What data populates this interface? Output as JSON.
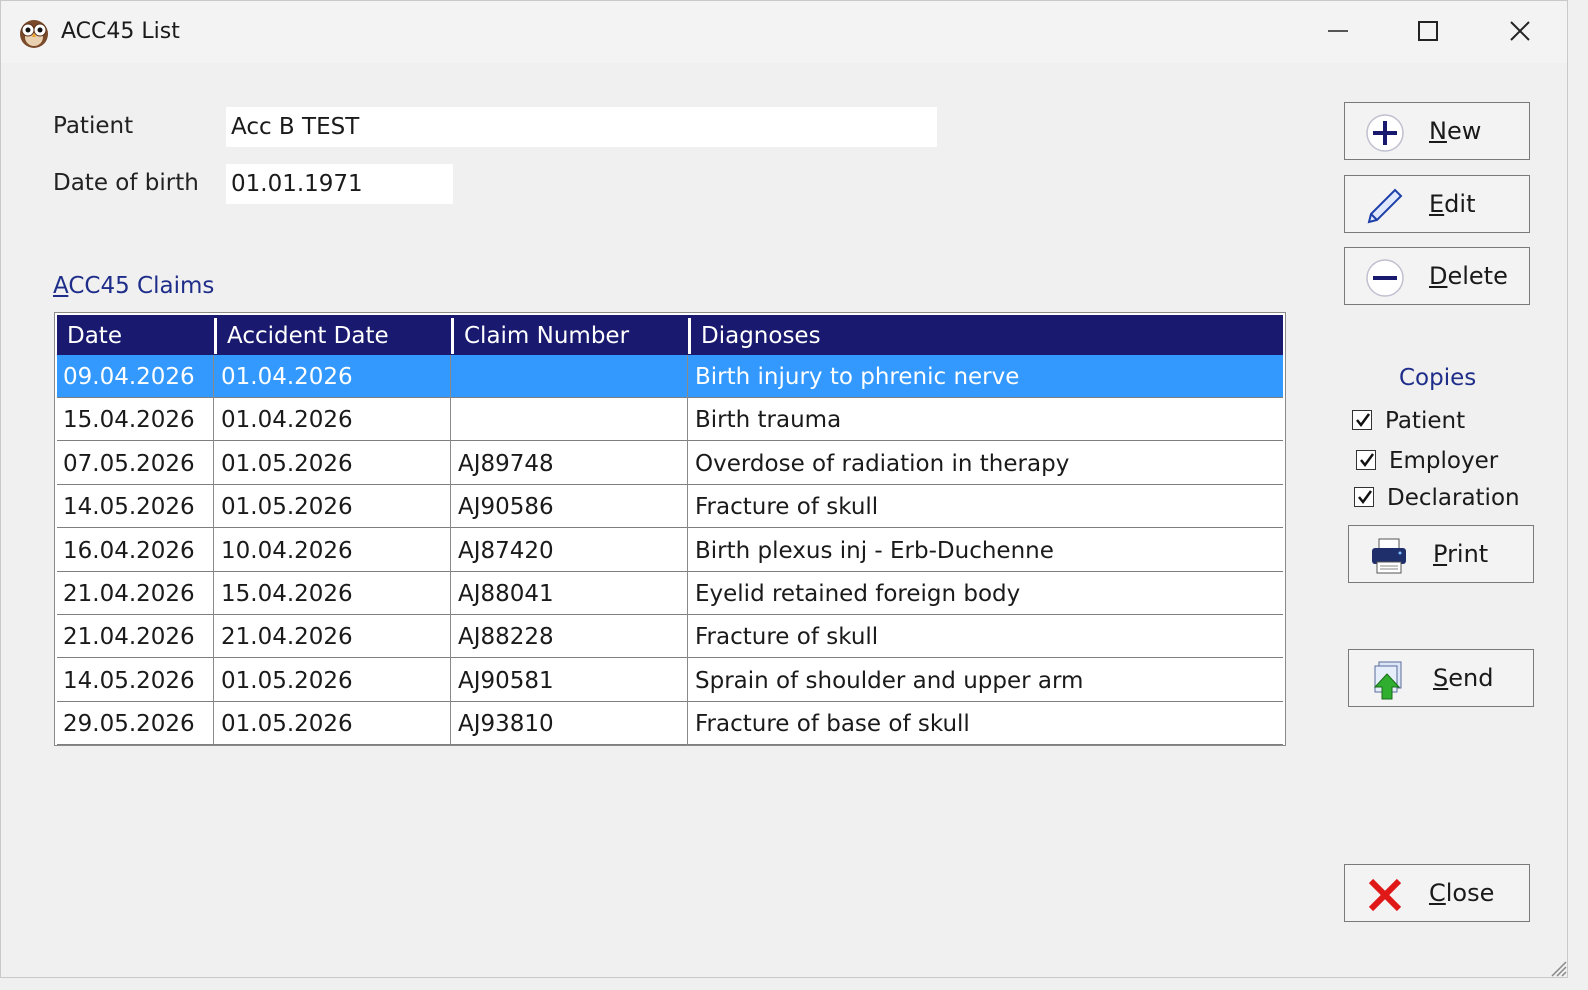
{
  "window": {
    "title": "ACC45 List"
  },
  "patient": {
    "label": "Patient",
    "value": "Acc B TEST"
  },
  "dob": {
    "label": "Date of birth",
    "value": "01.01.1971"
  },
  "claims": {
    "title": "ACC45 Claims",
    "columns": [
      "Date",
      "Accident Date",
      "Claim Number",
      "Diagnoses"
    ],
    "rows": [
      [
        "09.04.2026",
        "01.04.2026",
        "",
        "Birth injury to phrenic nerve"
      ],
      [
        "15.04.2026",
        "01.04.2026",
        "",
        "Birth trauma"
      ],
      [
        "07.05.2026",
        "01.05.2026",
        "AJ89748",
        "Overdose of radiation in therapy"
      ],
      [
        "14.05.2026",
        "01.05.2026",
        "AJ90586",
        "Fracture of skull"
      ],
      [
        "16.04.2026",
        "10.04.2026",
        "AJ87420",
        "Birth plexus inj - Erb-Duchenne"
      ],
      [
        "21.04.2026",
        "15.04.2026",
        "AJ88041",
        "Eyelid retained foreign body"
      ],
      [
        "21.04.2026",
        "21.04.2026",
        "AJ88228",
        "Fracture of skull"
      ],
      [
        "14.05.2026",
        "01.05.2026",
        "AJ90581",
        "Sprain of shoulder and upper arm"
      ],
      [
        "29.05.2026",
        "01.05.2026",
        "AJ93810",
        "Fracture of base of skull"
      ]
    ],
    "selected_row": 0
  },
  "buttons": {
    "new": "New",
    "edit": "Edit",
    "delete": "Delete",
    "print": "Print",
    "send": "Send",
    "close": "Close"
  },
  "copies": {
    "title": "Copies",
    "patient": {
      "label": "Patient",
      "checked": true
    },
    "employer": {
      "label": "Employer",
      "checked": true
    },
    "declaration": {
      "label": "Declaration",
      "checked": true
    }
  },
  "icons": {
    "app": "owl-icon",
    "new": "plus-circle-icon",
    "edit": "pencil-icon",
    "delete": "minus-circle-icon",
    "print": "printer-icon",
    "send": "send-up-arrow-icon",
    "close": "red-x-icon"
  },
  "colors": {
    "header_bg": "#191970",
    "selected_row": "#3399ff",
    "section_title": "#1e2d8a"
  }
}
